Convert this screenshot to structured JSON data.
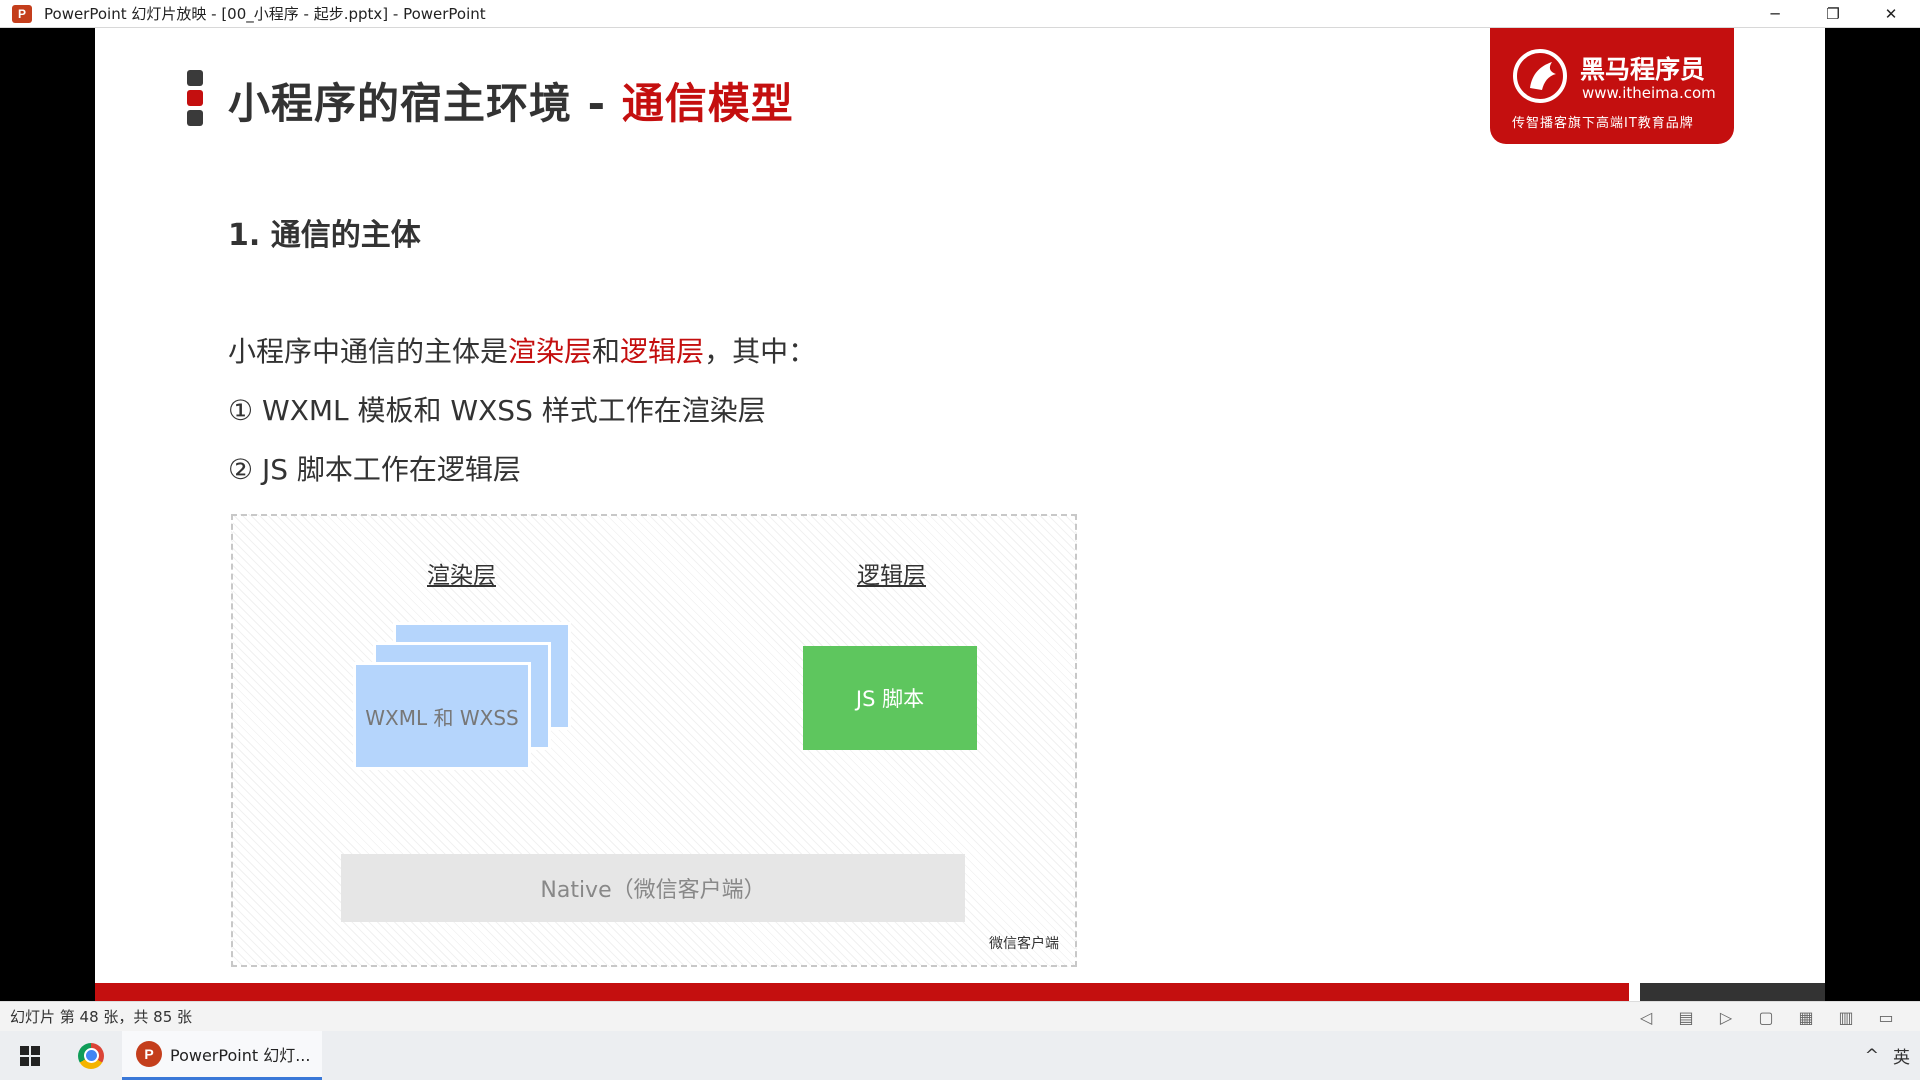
{
  "window": {
    "title": "PowerPoint 幻灯片放映 - [00_小程序 - 起步.pptx] - PowerPoint",
    "app_icon_letter": "P",
    "minimize": "─",
    "restore": "❐",
    "close": "✕"
  },
  "slide": {
    "title_main": "小程序的宿主环境 - ",
    "title_accent": "通信模型",
    "logo": {
      "name": "黑马程序员",
      "url": "www.itheima.com",
      "slogan": "传智播客旗下高端IT教育品牌"
    },
    "section_heading": "1. 通信的主体",
    "intro": {
      "part1": "小程序中通信的主体是",
      "red1": "渲染层",
      "part2": "和",
      "red2": "逻辑层",
      "part3": "，其中："
    },
    "item1": "①  WXML 模板和 WXSS 样式工作在渲染层",
    "item2": "②  JS 脚本工作在逻辑层",
    "diagram": {
      "render_label": "渲染层",
      "logic_label": "逻辑层",
      "card_text": "WXML 和 WXSS",
      "js_box": "JS 脚本",
      "native_box": "Native（微信客户端）",
      "client_label": "微信客户端"
    }
  },
  "statusbar": {
    "slide_info": "幻灯片 第 48 张，共 85 张"
  },
  "taskbar": {
    "ppt_label": "PowerPoint 幻灯...",
    "ppt_icon_letter": "P",
    "tray_chevron": "^",
    "ime": "英"
  },
  "colors": {
    "accent_red": "#c40f0f",
    "card_blue": "#b5d5fc",
    "js_green": "#5ec65e"
  }
}
